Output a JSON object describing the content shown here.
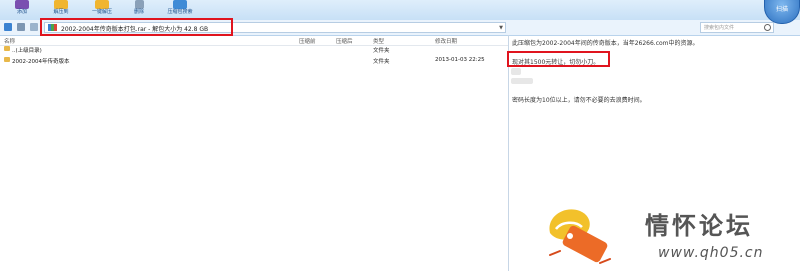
{
  "toolbar": {
    "buttons": [
      {
        "label": "添加",
        "color": "#7a4fb0"
      },
      {
        "label": "解压到",
        "color": "#f0b52f"
      },
      {
        "label": "一键解压",
        "color": "#f0b52f"
      },
      {
        "label": "删除",
        "color": "#8aa0b8"
      },
      {
        "label": "压缩包搜索",
        "color": "#3f8bd6"
      }
    ]
  },
  "address": {
    "path": "2002-2004年传奇版本打包.rar - 解包大小为 42.8 GB",
    "search_placeholder": "搜索包内文件"
  },
  "brand_button": {
    "label": "扫描"
  },
  "file_list": {
    "columns": [
      "名称",
      "压缩前",
      "压缩后",
      "类型",
      "修改日期"
    ],
    "rows": [
      {
        "name": "..(上级目录)",
        "before": "",
        "after": "",
        "type": "文件夹",
        "date": ""
      },
      {
        "name": "2002-2004年传奇版本",
        "before": "",
        "after": "",
        "type": "文件夹",
        "date": "2013-01-03 22:25"
      }
    ]
  },
  "info_panel": {
    "line1": "此压缩包为2002-2004年间的传奇版本，当年26266.com中的资源。",
    "line2": "现对其1500元转让，切勿小刀。",
    "line3": "密码长度为10位以上，请勿不必要的去浪费时间。"
  },
  "watermark": {
    "title": "情怀论坛",
    "url": "www.qh05.cn"
  },
  "colors": {
    "highlight": "#e0141e",
    "toolbar": "#c7e0f6"
  }
}
